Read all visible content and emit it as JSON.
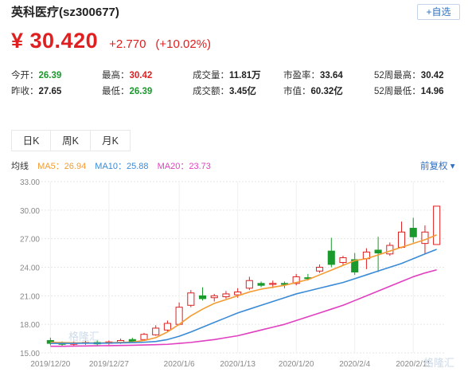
{
  "stock": {
    "title": "英科医疗(sz300677)",
    "add_label": "+自选",
    "price": "¥ 30.420",
    "change": "+2.770",
    "change_pct": "(+10.02%)"
  },
  "stats": [
    {
      "label": "今开：",
      "value": "26.39",
      "color": "green"
    },
    {
      "label": "最高：",
      "value": "30.42",
      "color": "red"
    },
    {
      "label": "成交量：",
      "value": "11.81万",
      "color": "dark"
    },
    {
      "label": "市盈率：",
      "value": "33.64",
      "color": "dark"
    },
    {
      "label": "52周最高：",
      "value": "30.42",
      "color": "dark"
    },
    {
      "label": "昨收：",
      "value": "27.65",
      "color": "dark"
    },
    {
      "label": "最低：",
      "value": "26.39",
      "color": "green"
    },
    {
      "label": "成交额：",
      "value": "3.45亿",
      "color": "dark"
    },
    {
      "label": "市值：",
      "value": "60.32亿",
      "color": "dark"
    },
    {
      "label": "52周最低：",
      "value": "14.96",
      "color": "dark"
    }
  ],
  "tabs": [
    {
      "label": "日K",
      "active": true
    },
    {
      "label": "周K",
      "active": false
    },
    {
      "label": "月K",
      "active": false
    }
  ],
  "ma_legend": {
    "title": "均线",
    "ma5": "MA5：26.94",
    "ma10": "MA10：25.88",
    "ma20": "MA20：23.73"
  },
  "adjust_label": "前复权",
  "watermarks": [
    "格隆汇",
    "格隆汇"
  ],
  "colors": {
    "up": "#e02020",
    "down": "#1a9a2c",
    "ma5": "#f39c33",
    "ma10": "#3a8bd6",
    "ma20": "#e040c0",
    "accent": "#2f6fbf"
  },
  "chart_data": {
    "type": "candlestick",
    "y_ticks": [
      "33.00",
      "30.00",
      "27.00",
      "24.00",
      "21.00",
      "18.00",
      "15.00"
    ],
    "ylim": [
      15,
      33
    ],
    "x_ticks": [
      {
        "label": "2019/12/20",
        "index": 0
      },
      {
        "label": "2019/12/27",
        "index": 5
      },
      {
        "label": "2020/1/6",
        "index": 11
      },
      {
        "label": "2020/1/13",
        "index": 16
      },
      {
        "label": "2020/1/20",
        "index": 21
      },
      {
        "label": "2020/2/4",
        "index": 26
      },
      {
        "label": "2020/2/11",
        "index": 31
      }
    ],
    "candles": [
      {
        "o": 16.3,
        "c": 16.0,
        "h": 16.6,
        "l": 15.8
      },
      {
        "o": 16.0,
        "c": 15.9,
        "h": 16.2,
        "l": 15.7
      },
      {
        "o": 15.9,
        "c": 16.05,
        "h": 16.2,
        "l": 15.75
      },
      {
        "o": 16.0,
        "c": 16.1,
        "h": 16.25,
        "l": 15.85
      },
      {
        "o": 16.1,
        "c": 15.95,
        "h": 16.3,
        "l": 15.8
      },
      {
        "o": 16.0,
        "c": 16.15,
        "h": 16.3,
        "l": 15.85
      },
      {
        "o": 16.1,
        "c": 16.3,
        "h": 16.5,
        "l": 15.95
      },
      {
        "o": 16.4,
        "c": 16.2,
        "h": 16.6,
        "l": 16.05
      },
      {
        "o": 16.4,
        "c": 16.95,
        "h": 17.1,
        "l": 16.3
      },
      {
        "o": 16.9,
        "c": 17.6,
        "h": 17.9,
        "l": 16.8
      },
      {
        "o": 17.4,
        "c": 18.1,
        "h": 18.4,
        "l": 17.2
      },
      {
        "o": 18.0,
        "c": 19.8,
        "h": 20.3,
        "l": 17.9
      },
      {
        "o": 20.0,
        "c": 21.3,
        "h": 21.6,
        "l": 19.8
      },
      {
        "o": 21.0,
        "c": 20.7,
        "h": 21.9,
        "l": 20.5
      },
      {
        "o": 20.8,
        "c": 21.0,
        "h": 21.2,
        "l": 20.4
      },
      {
        "o": 20.9,
        "c": 21.2,
        "h": 21.5,
        "l": 20.7
      },
      {
        "o": 21.1,
        "c": 21.4,
        "h": 21.8,
        "l": 20.8
      },
      {
        "o": 21.8,
        "c": 22.6,
        "h": 23.0,
        "l": 21.6
      },
      {
        "o": 22.3,
        "c": 22.1,
        "h": 22.5,
        "l": 21.9
      },
      {
        "o": 22.2,
        "c": 22.3,
        "h": 22.6,
        "l": 21.8
      },
      {
        "o": 22.3,
        "c": 22.2,
        "h": 22.5,
        "l": 21.8
      },
      {
        "o": 22.3,
        "c": 23.0,
        "h": 23.3,
        "l": 22.1
      },
      {
        "o": 22.9,
        "c": 22.8,
        "h": 23.3,
        "l": 22.6
      },
      {
        "o": 23.6,
        "c": 24.0,
        "h": 24.3,
        "l": 23.4
      },
      {
        "o": 25.7,
        "c": 24.3,
        "h": 27.1,
        "l": 24.0
      },
      {
        "o": 24.5,
        "c": 25.0,
        "h": 25.2,
        "l": 24.2
      },
      {
        "o": 24.8,
        "c": 23.5,
        "h": 25.5,
        "l": 23.2
      },
      {
        "o": 24.9,
        "c": 25.6,
        "h": 26.0,
        "l": 23.8
      },
      {
        "o": 25.8,
        "c": 25.5,
        "h": 27.2,
        "l": 23.5
      },
      {
        "o": 25.4,
        "c": 26.3,
        "h": 26.6,
        "l": 25.2
      },
      {
        "o": 26.1,
        "c": 27.7,
        "h": 28.8,
        "l": 26.0
      },
      {
        "o": 28.1,
        "c": 27.2,
        "h": 29.2,
        "l": 26.6
      },
      {
        "o": 26.5,
        "c": 27.7,
        "h": 28.4,
        "l": 25.4
      },
      {
        "o": 26.39,
        "c": 30.42,
        "h": 30.42,
        "l": 26.39
      }
    ],
    "series": [
      {
        "name": "MA5",
        "values": [
          16.1,
          16.08,
          16.05,
          16.05,
          16.03,
          16.06,
          16.1,
          16.14,
          16.3,
          16.6,
          17.2,
          18.0,
          18.9,
          19.6,
          20.2,
          20.6,
          21.0,
          21.4,
          21.7,
          21.9,
          22.1,
          22.4,
          22.7,
          23.2,
          23.7,
          24.2,
          24.7,
          24.9,
          25.3,
          25.7,
          26.1,
          26.5,
          26.9,
          27.4
        ]
      },
      {
        "name": "MA10",
        "values": [
          16.0,
          16.0,
          16.0,
          16.02,
          16.02,
          16.03,
          16.05,
          16.08,
          16.12,
          16.2,
          16.4,
          16.75,
          17.2,
          17.7,
          18.2,
          18.7,
          19.2,
          19.6,
          20.0,
          20.4,
          20.8,
          21.2,
          21.5,
          21.8,
          22.1,
          22.4,
          22.8,
          23.2,
          23.6,
          24.0,
          24.4,
          24.9,
          25.4,
          25.88
        ]
      },
      {
        "name": "MA20",
        "values": [
          15.7,
          15.7,
          15.72,
          15.73,
          15.75,
          15.76,
          15.78,
          15.8,
          15.83,
          15.86,
          15.9,
          16.0,
          16.1,
          16.25,
          16.4,
          16.6,
          16.8,
          17.1,
          17.4,
          17.7,
          18.0,
          18.4,
          18.8,
          19.2,
          19.6,
          20.0,
          20.5,
          21.0,
          21.5,
          22.0,
          22.5,
          23.0,
          23.4,
          23.73
        ]
      }
    ]
  }
}
